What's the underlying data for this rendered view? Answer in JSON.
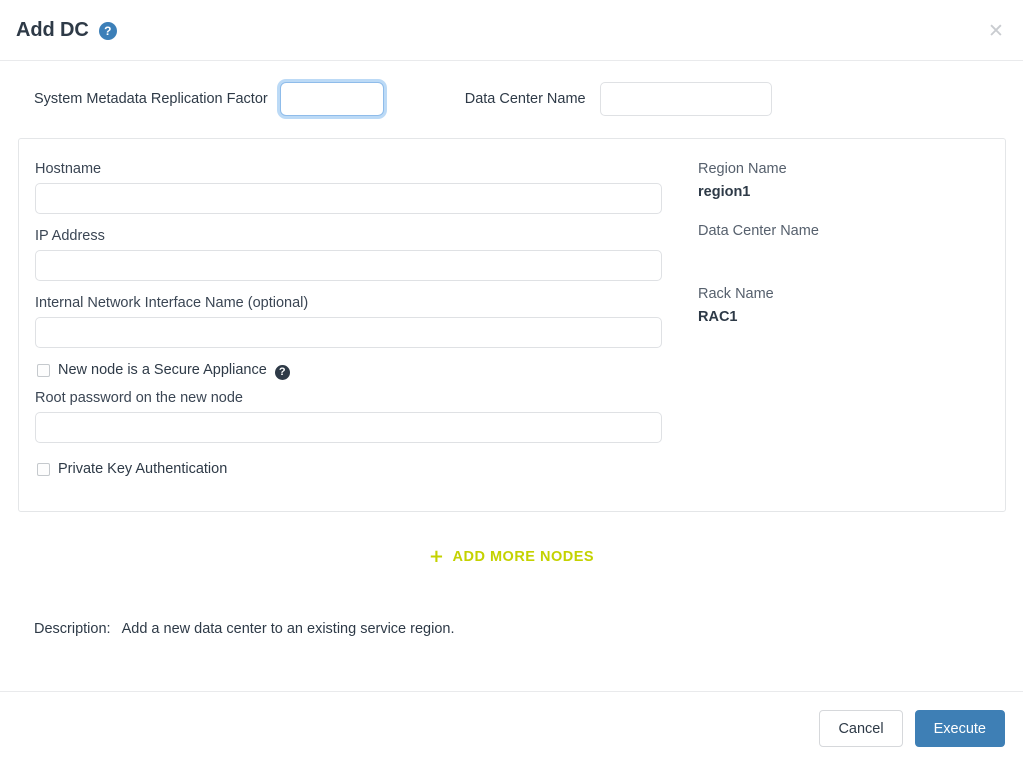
{
  "dialog": {
    "title": "Add DC",
    "help_icon": "question-circle-icon",
    "close_icon": "✕"
  },
  "top_row": {
    "replication_factor": {
      "label": "System Metadata Replication Factor",
      "value": "",
      "placeholder": ""
    },
    "data_center_name": {
      "label": "Data Center Name",
      "value": "",
      "placeholder": ""
    }
  },
  "node_panel": {
    "left": {
      "hostname": {
        "label": "Hostname",
        "value": "",
        "placeholder": ""
      },
      "ip_address": {
        "label": "IP Address",
        "value": "",
        "placeholder": ""
      },
      "internal_nic": {
        "label": "Internal Network Interface Name (optional)",
        "value": "",
        "placeholder": ""
      },
      "secure_appliance": {
        "label": "New node is a Secure Appliance",
        "checked": false,
        "help_icon": "question-circle-icon"
      },
      "root_password": {
        "label": "Root password on the new node",
        "value": "",
        "placeholder": ""
      },
      "private_key_auth": {
        "label": "Private Key Authentication",
        "checked": false
      }
    },
    "right": {
      "region_name": {
        "label": "Region Name",
        "value": "region1"
      },
      "data_center_name": {
        "label": "Data Center Name",
        "value": ""
      },
      "rack_name": {
        "label": "Rack Name",
        "value": "RAC1"
      }
    }
  },
  "add_more_nodes": {
    "plus": "+",
    "label": "ADD MORE NODES"
  },
  "description": {
    "label": "Description:",
    "text": "Add a new data center to an existing service region."
  },
  "footer": {
    "cancel_label": "Cancel",
    "execute_label": "Execute"
  },
  "colors": {
    "accent_blue": "#3e7fb5",
    "add_more_green": "#c4d200",
    "text": "#2e3a47",
    "border": "#e4e6e8"
  }
}
